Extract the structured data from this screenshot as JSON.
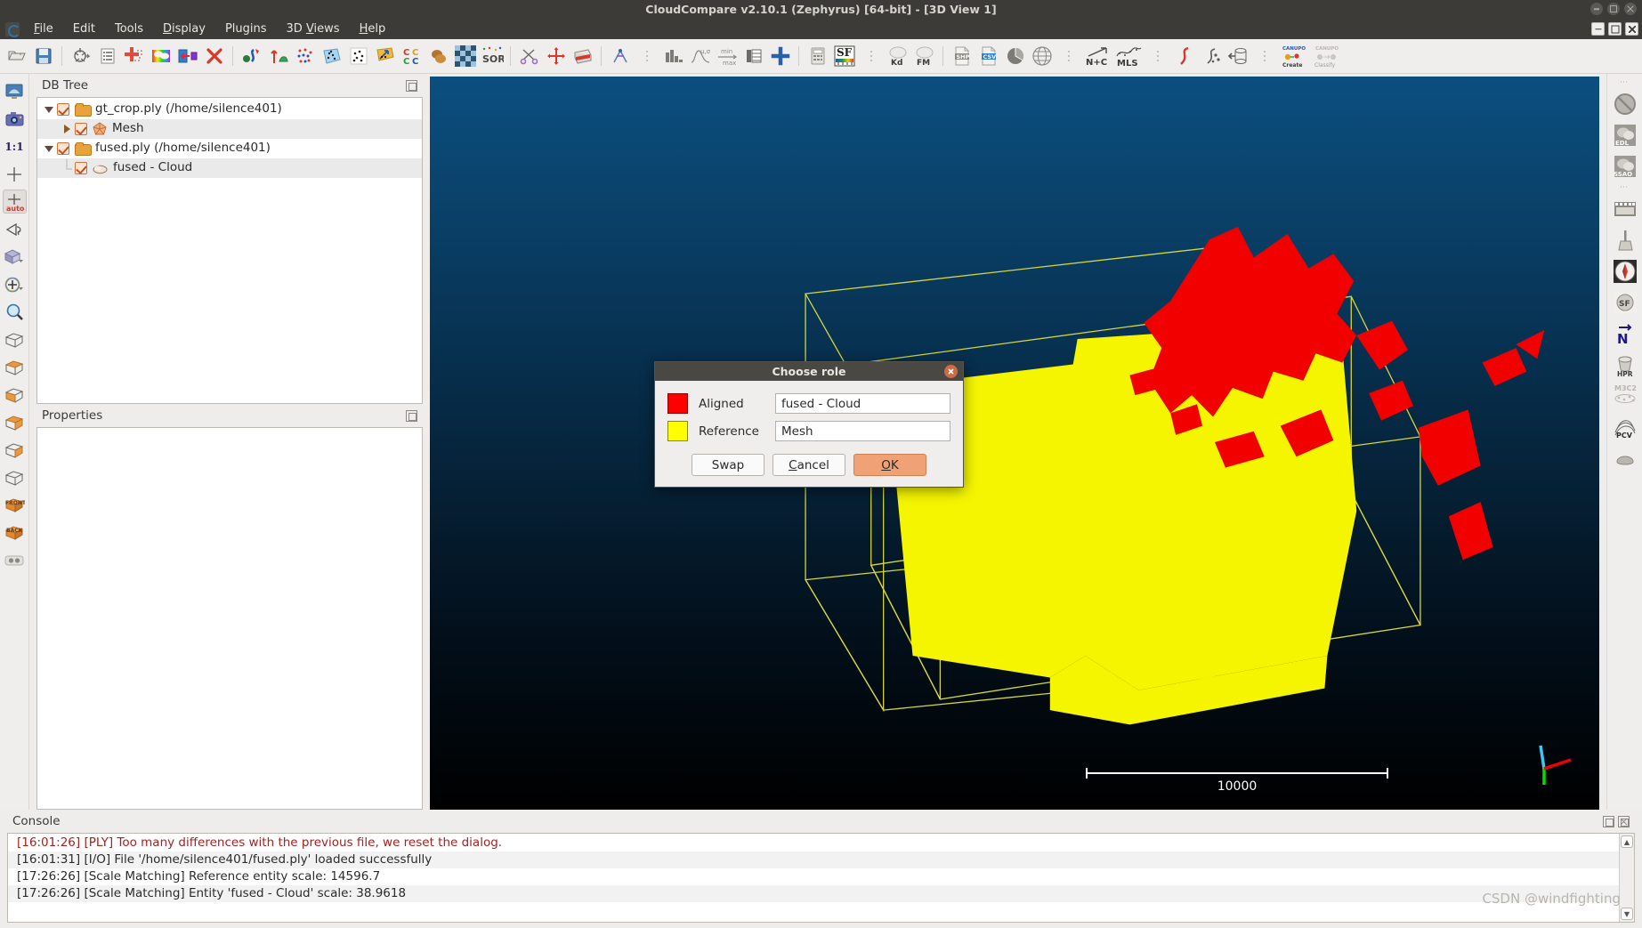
{
  "window": {
    "title": "CloudCompare v2.10.1 (Zephyrus) [64-bit] - [3D View 1]",
    "controls": [
      "minimize",
      "maximize",
      "close"
    ],
    "mdi_controls": [
      "minimize",
      "restore",
      "close"
    ]
  },
  "menubar": {
    "app_icon": "cloudcompare-logo-icon",
    "items": [
      {
        "label": "File",
        "mnemonic": "F"
      },
      {
        "label": "Edit",
        "mnemonic": "E"
      },
      {
        "label": "Tools",
        "mnemonic": "T"
      },
      {
        "label": "Display",
        "mnemonic": "D"
      },
      {
        "label": "Plugins",
        "mnemonic": "P"
      },
      {
        "label": "3D Views",
        "mnemonic": "V"
      },
      {
        "label": "Help",
        "mnemonic": "H"
      }
    ]
  },
  "main_toolbar": {
    "items": [
      {
        "name": "open-icon",
        "kind": "icon"
      },
      {
        "name": "save-icon",
        "kind": "icon"
      },
      {
        "name": "separator",
        "kind": "sep"
      },
      {
        "name": "clone-icon",
        "kind": "icon"
      },
      {
        "name": "properties-list-icon",
        "kind": "icon"
      },
      {
        "name": "merge-icon",
        "kind": "icon"
      },
      {
        "name": "colors-icon",
        "kind": "icon"
      },
      {
        "name": "apply-transformation-icon",
        "kind": "icon"
      },
      {
        "name": "delete-icon",
        "kind": "icon"
      },
      {
        "name": "separator",
        "kind": "sep"
      },
      {
        "name": "register-icon",
        "kind": "icon"
      },
      {
        "name": "align-icon",
        "kind": "icon"
      },
      {
        "name": "subsample-icon",
        "kind": "icon"
      },
      {
        "name": "segment-cloud-icon",
        "kind": "icon"
      },
      {
        "name": "compute-normals-icon",
        "kind": "icon"
      },
      {
        "name": "point-picking-icon",
        "kind": "icon"
      },
      {
        "name": "cloud-cloud-dist-icon",
        "label": "CC",
        "kind": "label-icon"
      },
      {
        "name": "cloud-mesh-dist-icon",
        "kind": "icon"
      },
      {
        "name": "checkerboard-icon",
        "kind": "icon"
      },
      {
        "name": "sor-filter-icon",
        "label": "SOR",
        "kind": "label-icon"
      },
      {
        "name": "separator",
        "kind": "sep"
      },
      {
        "name": "scissors-icon",
        "kind": "icon"
      },
      {
        "name": "translate-rotate-icon",
        "kind": "icon"
      },
      {
        "name": "cross-section-icon",
        "kind": "icon"
      },
      {
        "name": "separator",
        "kind": "sep"
      },
      {
        "name": "sf-gradient-icon",
        "kind": "icon"
      },
      {
        "name": "grip-handle",
        "kind": "grip"
      },
      {
        "name": "histogram-icon",
        "kind": "icon"
      },
      {
        "name": "gaussian-filter-icon",
        "kind": "icon"
      },
      {
        "name": "min-max-icon",
        "kind": "icon"
      },
      {
        "name": "sf-to-rgb-icon",
        "kind": "icon"
      },
      {
        "name": "add-sf-icon",
        "kind": "icon"
      },
      {
        "name": "separator",
        "kind": "sep"
      },
      {
        "name": "calculator-icon",
        "kind": "icon"
      },
      {
        "name": "sf-colorscale-icon",
        "label": "SF",
        "kind": "label-icon"
      },
      {
        "name": "grip-handle",
        "kind": "grip"
      },
      {
        "name": "kd-tree-icon",
        "label": "Kd",
        "kind": "label-icon"
      },
      {
        "name": "fm-icon",
        "label": "FM",
        "kind": "label-icon"
      },
      {
        "name": "separator",
        "kind": "sep"
      },
      {
        "name": "export-shp-icon",
        "label": "SHP",
        "kind": "label-icon"
      },
      {
        "name": "export-csv-icon",
        "label": "CSV",
        "kind": "label-icon"
      },
      {
        "name": "pie-icon",
        "kind": "icon"
      },
      {
        "name": "globe-icon",
        "kind": "icon"
      },
      {
        "name": "grip-handle",
        "kind": "grip"
      },
      {
        "name": "normals-to-colors-icon",
        "label": "N+C",
        "kind": "label-icon"
      },
      {
        "name": "mls-smoothing-icon",
        "label": "MLS",
        "kind": "label-icon"
      },
      {
        "name": "grip-handle",
        "kind": "grip"
      },
      {
        "name": "curvature-icon",
        "kind": "icon"
      },
      {
        "name": "poisson-recon-icon",
        "kind": "icon"
      },
      {
        "name": "surface-of-revolution-icon",
        "kind": "icon"
      },
      {
        "name": "grip-handle",
        "kind": "grip"
      },
      {
        "name": "canupo-create-icon",
        "label": "CANUPO Create",
        "kind": "label-icon"
      },
      {
        "name": "canupo-classify-icon",
        "label": "CANUPO Classify",
        "kind": "label-icon"
      }
    ]
  },
  "left_toolbar": {
    "items": [
      {
        "name": "refresh-view-icon",
        "selected": false
      },
      {
        "name": "screenshot-icon",
        "selected": false
      },
      {
        "name": "zoom-one-to-one-icon",
        "label": "1:1",
        "selected": false
      },
      {
        "name": "global-zoom-icon",
        "selected": false
      },
      {
        "name": "auto-zoom-icon",
        "label": "auto",
        "selected": true
      },
      {
        "name": "pivot-rotation-icon",
        "selected": false
      },
      {
        "name": "ortho-perspective-icon",
        "selected": false
      },
      {
        "name": "object-perspective-icon",
        "selected": false
      },
      {
        "name": "zoom-icon",
        "selected": false
      },
      {
        "name": "view-default-icon",
        "selected": false
      },
      {
        "name": "view-top-icon",
        "selected": false
      },
      {
        "name": "view-bottom-icon",
        "selected": false
      },
      {
        "name": "view-left-icon",
        "selected": false
      },
      {
        "name": "view-right-icon",
        "selected": false
      },
      {
        "name": "view-iso1-icon",
        "selected": false
      },
      {
        "name": "view-front-icon",
        "label": "FRONT",
        "selected": false
      },
      {
        "name": "view-back-icon",
        "label": "BACK",
        "selected": false
      },
      {
        "name": "stereo-mode-icon",
        "selected": false
      }
    ]
  },
  "right_toolbar": {
    "items": [
      {
        "name": "grip-handle",
        "kind": "grip"
      },
      {
        "name": "no-shader-icon",
        "kind": "icon"
      },
      {
        "name": "edl-shader-icon",
        "label": "EDL",
        "kind": "label-icon"
      },
      {
        "name": "ssao-shader-icon",
        "label": "SSAO",
        "kind": "label-icon"
      },
      {
        "name": "grip-handle",
        "kind": "grip"
      },
      {
        "name": "animation-icon",
        "kind": "icon"
      },
      {
        "name": "broom-cleanup-icon",
        "kind": "icon"
      },
      {
        "name": "compass-icon",
        "kind": "icon"
      },
      {
        "name": "sf-plugin-icon",
        "label": "SF",
        "kind": "label-icon"
      },
      {
        "name": "north-arrow-icon",
        "label": "N",
        "kind": "label-icon"
      },
      {
        "name": "hpr-icon",
        "label": "HPR",
        "kind": "label-icon"
      },
      {
        "name": "m3c2-icon",
        "label": "M3C2",
        "kind": "label-icon"
      },
      {
        "name": "pcv-icon",
        "label": "PCV",
        "kind": "label-icon"
      },
      {
        "name": "qhull-icon",
        "kind": "icon"
      }
    ]
  },
  "db_tree": {
    "title": "DB Tree",
    "rows": [
      {
        "expander": "down",
        "checked": true,
        "icon": "folder-icon",
        "label": "gt_crop.ply (/home/silence401)",
        "depth": 0,
        "highlight": false
      },
      {
        "expander": "right",
        "checked": true,
        "icon": "mesh-icon",
        "label": "Mesh",
        "depth": 1,
        "highlight": true
      },
      {
        "expander": "down",
        "checked": true,
        "icon": "folder-icon",
        "label": "fused.ply (/home/silence401)",
        "depth": 0,
        "highlight": false
      },
      {
        "expander": "none",
        "checked": true,
        "icon": "cloud-icon",
        "label": "fused - Cloud",
        "depth": 1,
        "highlight": true
      }
    ]
  },
  "properties": {
    "title": "Properties",
    "rows": []
  },
  "viewport": {
    "scale_bar_value": "10000",
    "axis_gizmo": "xyz-axis-gizmo",
    "background_top": "#0b4f80",
    "background_bottom": "#000000",
    "aligned_color": "#ff0000",
    "reference_color": "#ffff00",
    "bbox_color": "#dcdc50"
  },
  "dialog": {
    "title": "Choose role",
    "close_icon": "close-icon",
    "rows": [
      {
        "swatch_color": "#ff0000",
        "label": "Aligned",
        "value": "fused - Cloud",
        "swatch_name": "aligned-color-swatch"
      },
      {
        "swatch_color": "#ffff00",
        "label": "Reference",
        "value": "Mesh",
        "swatch_name": "reference-color-swatch"
      }
    ],
    "buttons": [
      {
        "label": "Swap",
        "name": "swap-button",
        "mnemonic": "",
        "default": false
      },
      {
        "label": "Cancel",
        "name": "cancel-button",
        "mnemonic": "C",
        "default": false
      },
      {
        "label": "OK",
        "name": "ok-button",
        "mnemonic": "O",
        "default": true
      }
    ],
    "default_button_color": "#f0a176"
  },
  "console": {
    "title": "Console",
    "lines": [
      {
        "text": "[16:01:26] [PLY] Too many differences with the previous file, we reset the dialog.",
        "level": "error"
      },
      {
        "text": "[16:01:31] [I/O] File '/home/silence401/fused.ply' loaded successfully",
        "level": "info"
      },
      {
        "text": "[17:26:26] [Scale Matching] Reference entity scale: 14596.7",
        "level": "info"
      },
      {
        "text": "[17:26:26] [Scale Matching] Entity 'fused - Cloud' scale: 38.9618",
        "level": "info"
      }
    ],
    "scroll_up": "▲",
    "scroll_down": "▼"
  },
  "watermark": {
    "text": "CSDN @windfighting"
  }
}
